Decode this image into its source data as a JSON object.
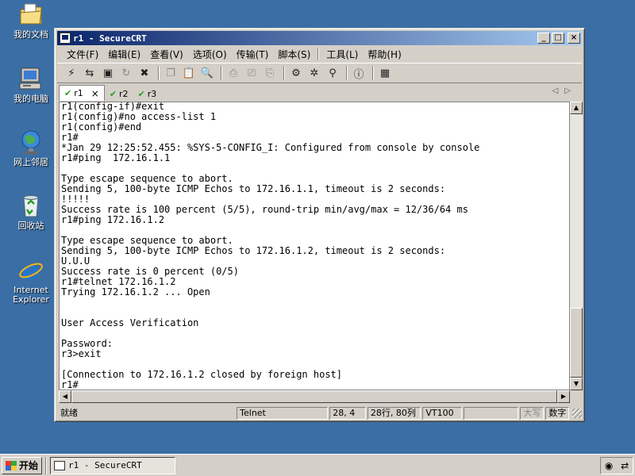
{
  "desktop": {
    "icons": [
      {
        "label": "我的文档",
        "icon": "folder-documents-icon"
      },
      {
        "label": "我的电脑",
        "icon": "computer-icon"
      },
      {
        "label": "网上邻居",
        "icon": "network-icon"
      },
      {
        "label": "回收站",
        "icon": "recycle-bin-icon"
      },
      {
        "label": "Internet Explorer",
        "icon": "ie-icon"
      }
    ]
  },
  "window": {
    "title": "r1 - SecureCRT",
    "controls": {
      "minimize": "_",
      "maximize": "□",
      "close": "×"
    }
  },
  "menu": [
    {
      "label": "文件(F)"
    },
    {
      "label": "编辑(E)"
    },
    {
      "label": "查看(V)"
    },
    {
      "label": "选项(O)"
    },
    {
      "label": "传输(T)"
    },
    {
      "label": "脚本(S)"
    },
    {
      "label": "工具(L)"
    },
    {
      "label": "帮助(H)"
    }
  ],
  "tabs": [
    {
      "label": "r1",
      "active": true,
      "close": "×"
    },
    {
      "label": "r2",
      "active": false
    },
    {
      "label": "r3",
      "active": false
    }
  ],
  "terminal": {
    "lines": [
      "r1(config-if)#exit",
      "r1(config)#no access-list 1",
      "r1(config)#end",
      "r1#",
      "*Jan 29 12:25:52.455: %SYS-5-CONFIG_I: Configured from console by console",
      "r1#ping  172.16.1.1",
      "",
      "Type escape sequence to abort.",
      "Sending 5, 100-byte ICMP Echos to 172.16.1.1, timeout is 2 seconds:",
      "!!!!!",
      "Success rate is 100 percent (5/5), round-trip min/avg/max = 12/36/64 ms",
      "r1#ping 172.16.1.2",
      "",
      "Type escape sequence to abort.",
      "Sending 5, 100-byte ICMP Echos to 172.16.1.2, timeout is 2 seconds:",
      "U.U.U",
      "Success rate is 0 percent (0/5)",
      "r1#telnet 172.16.1.2",
      "Trying 172.16.1.2 ... Open",
      "",
      "",
      "User Access Verification",
      "",
      "Password:",
      "r3>exit",
      "",
      "[Connection to 172.16.1.2 closed by foreign host]",
      "r1#"
    ]
  },
  "statusbar": {
    "ready": "就绪",
    "protocol": "Telnet",
    "cursor": "28, 4",
    "size": "28行, 80列",
    "emulation": "VT100",
    "caps": "大写",
    "num": "数字"
  },
  "taskbar": {
    "start_label": "开始",
    "task_label": "r1 - SecureCRT"
  }
}
